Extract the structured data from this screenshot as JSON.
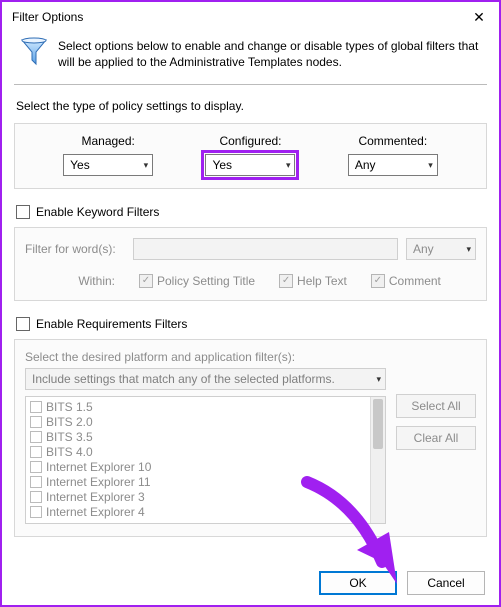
{
  "window": {
    "title": "Filter Options",
    "close_glyph": "✕"
  },
  "intro": "Select options below to enable and change or disable types of global filters that will be applied to the Administrative Templates nodes.",
  "policy_section": {
    "heading": "Select the type of policy settings to display.",
    "managed_label": "Managed:",
    "managed_value": "Yes",
    "configured_label": "Configured:",
    "configured_value": "Yes",
    "commented_label": "Commented:",
    "commented_value": "Any"
  },
  "keyword_section": {
    "enable_label": "Enable Keyword Filters",
    "filter_label": "Filter for word(s):",
    "match_value": "Any",
    "within_label": "Within:",
    "cb_title": "Policy Setting Title",
    "cb_help": "Help Text",
    "cb_comment": "Comment"
  },
  "requirements_section": {
    "enable_label": "Enable Requirements Filters",
    "desc": "Select the desired platform and application filter(s):",
    "mode": "Include settings that match any of the selected platforms.",
    "items": [
      "BITS 1.5",
      "BITS 2.0",
      "BITS 3.5",
      "BITS 4.0",
      "Internet Explorer 10",
      "Internet Explorer 11",
      "Internet Explorer 3",
      "Internet Explorer 4"
    ],
    "select_all": "Select All",
    "clear_all": "Clear All"
  },
  "footer": {
    "ok": "OK",
    "cancel": "Cancel"
  },
  "colors": {
    "accent": "#a020f0"
  }
}
